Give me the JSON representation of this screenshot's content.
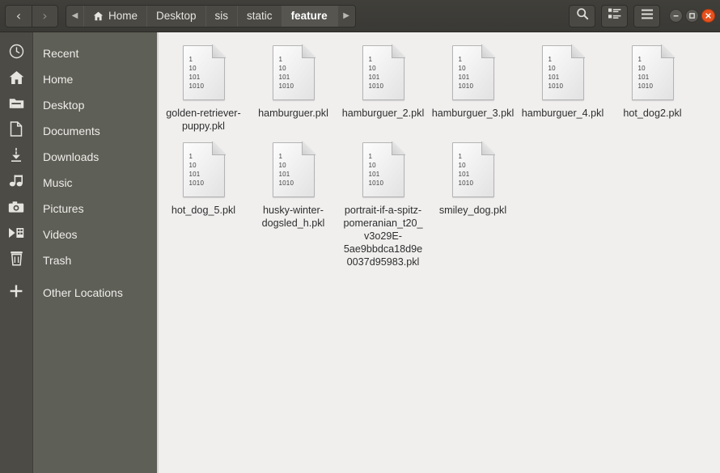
{
  "window": {
    "title": "feature",
    "controls": [
      {
        "name": "minimize",
        "glyph": "—"
      },
      {
        "name": "maximize",
        "glyph": "▣"
      },
      {
        "name": "close",
        "glyph": "✕"
      }
    ]
  },
  "header": {
    "back_label": "‹",
    "forward_label": "›",
    "crumb_prev_label": "◀",
    "crumb_next_label": "▶",
    "breadcrumbs": [
      {
        "label": "Home",
        "icon": "home-icon",
        "active": false
      },
      {
        "label": "Desktop",
        "icon": "",
        "active": false
      },
      {
        "label": "sis",
        "icon": "",
        "active": false
      },
      {
        "label": "static",
        "icon": "",
        "active": false
      },
      {
        "label": "feature",
        "icon": "",
        "active": true
      }
    ],
    "tools": [
      {
        "name": "search-icon",
        "label": "Search"
      },
      {
        "name": "view-options-icon",
        "label": "View options"
      },
      {
        "name": "menu-icon",
        "label": "Menu"
      }
    ]
  },
  "sidebar": {
    "items": [
      {
        "label": "Recent",
        "icon": "clock-icon"
      },
      {
        "label": "Home",
        "icon": "home-icon"
      },
      {
        "label": "Desktop",
        "icon": "folder-icon"
      },
      {
        "label": "Documents",
        "icon": "document-icon"
      },
      {
        "label": "Downloads",
        "icon": "download-icon"
      },
      {
        "label": "Music",
        "icon": "music-icon"
      },
      {
        "label": "Pictures",
        "icon": "camera-icon"
      },
      {
        "label": "Videos",
        "icon": "video-icon"
      },
      {
        "label": "Trash",
        "icon": "trash-icon"
      },
      {
        "label": "Other Locations",
        "icon": "plus-icon"
      }
    ]
  },
  "files": {
    "icon_bits": [
      "1",
      "10",
      "101",
      "1010"
    ],
    "items": [
      {
        "name": "golden-retriever-puppy.pkl"
      },
      {
        "name": "hamburguer.pkl"
      },
      {
        "name": "hamburguer_2.pkl"
      },
      {
        "name": "hamburguer_3.pkl"
      },
      {
        "name": "hamburguer_4.pkl"
      },
      {
        "name": "hot_dog2.pkl"
      },
      {
        "name": "hot_dog_5.pkl"
      },
      {
        "name": "husky-winter-dogsled_h.pkl"
      },
      {
        "name": "portrait-if-a-spitz-pomeranian_t20_v3o29E-5ae9bbdca18d9e0037d95983.pkl"
      },
      {
        "name": "smiley_dog.pkl"
      }
    ]
  },
  "colors": {
    "headerbar": "#3e3d38",
    "rail": "#4c4b45",
    "sidebar": "#5e5f56",
    "content": "#f0efee",
    "close_button": "#e8511d",
    "text_light": "#efedea",
    "text_dark": "#2e2e2e"
  }
}
